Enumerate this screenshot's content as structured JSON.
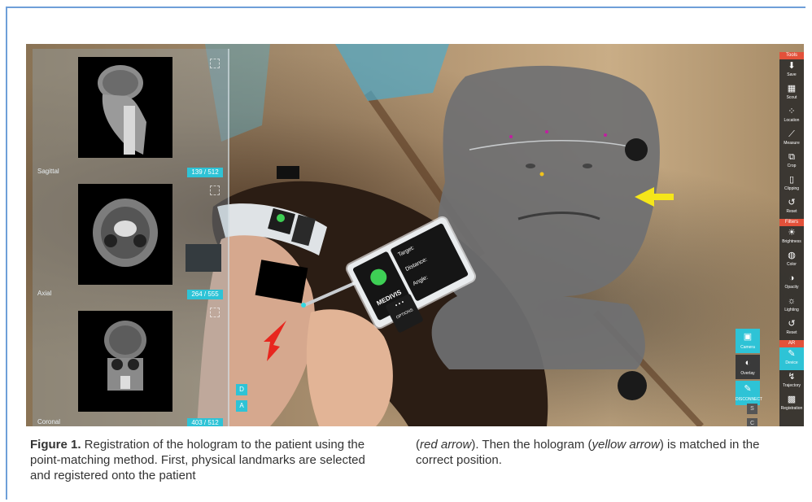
{
  "ct_views": [
    {
      "label": "Sagittal",
      "count": "139 / 512"
    },
    {
      "label": "Axial",
      "count": "264 / 555"
    },
    {
      "label": "Coronal",
      "count": "403 / 512"
    }
  ],
  "view_buttons": [
    "D",
    "A"
  ],
  "device": {
    "brand": "MEDIVIS",
    "target_label": "Target:",
    "distance_label": "Distance:",
    "angle_label": "Angle:",
    "options_label": "OPTIONS",
    "options_dots": "• • •"
  },
  "toolbar": {
    "tools_header": "Tools",
    "tools": [
      {
        "icon": "download-icon",
        "glyph": "⬇",
        "label": "Save"
      },
      {
        "icon": "grid-icon",
        "glyph": "▦",
        "label": "Scout"
      },
      {
        "icon": "location-icon",
        "glyph": "⁘",
        "label": "Location"
      },
      {
        "icon": "ruler-icon",
        "glyph": "⟋",
        "label": "Measure"
      },
      {
        "icon": "crop-icon",
        "glyph": "⧉",
        "label": "Crop"
      },
      {
        "icon": "clipping-icon",
        "glyph": "▯",
        "label": "Clipping"
      },
      {
        "icon": "reset-icon",
        "glyph": "↺",
        "label": "Reset"
      }
    ],
    "filters_header": "Filters",
    "filters": [
      {
        "icon": "brightness-icon",
        "glyph": "☀",
        "label": "Brightness"
      },
      {
        "icon": "color-icon",
        "glyph": "◍",
        "label": "Color"
      },
      {
        "icon": "opacity-icon",
        "glyph": "◑",
        "label": "Opacity"
      },
      {
        "icon": "lighting-icon",
        "glyph": "☼",
        "label": "Lighting"
      },
      {
        "icon": "reset-icon",
        "glyph": "↺",
        "label": "Reset"
      }
    ],
    "ar_header": "AR",
    "ar": [
      {
        "icon": "device-icon",
        "glyph": "✎",
        "label": "Device",
        "active": true
      },
      {
        "icon": "trajectory-icon",
        "glyph": "↯",
        "label": "Trajectory",
        "active": false
      },
      {
        "icon": "registration-icon",
        "glyph": "▩",
        "label": "Registration",
        "active": false
      }
    ]
  },
  "mini_panel": [
    {
      "icon": "camera-icon",
      "glyph": "▣",
      "label": "Camera",
      "active": true
    },
    {
      "icon": "overlay-icon",
      "glyph": "◐",
      "label": "Overlay",
      "active": false
    },
    {
      "icon": "disconnect-icon",
      "glyph": "✎",
      "label": "DISCONNECT",
      "active": true
    }
  ],
  "mini_small": [
    "S",
    "C"
  ],
  "caption": {
    "label": "Figure 1.",
    "text_left": " Registration of the hologram to the patient using the point-matching method. First, physical landmarks are selected and registered onto the patient",
    "text_right_open": "(",
    "red_arrow": "red arrow",
    "text_right_mid": "). Then the hologram (",
    "yellow_arrow": "yellow arrow",
    "text_right_end": ") is matched in the correct position."
  },
  "colors": {
    "accent": "#2ec3d6",
    "toolbar_header": "#e3513a",
    "red_arrow": "#e8261e",
    "yellow_arrow": "#f5e61a",
    "frame_border": "#6f9fd8"
  }
}
